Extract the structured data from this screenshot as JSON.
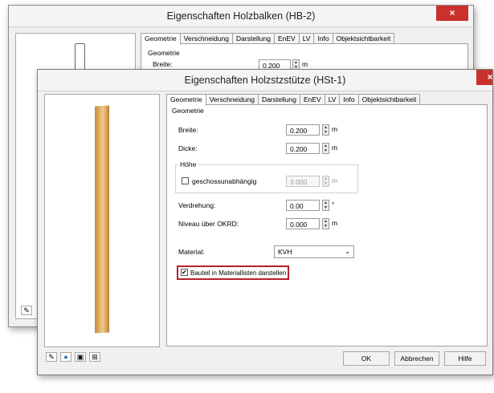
{
  "back_dialog": {
    "title": "Eigenschaften Holzbalken (HB-2)",
    "close": "×",
    "tabs": [
      "Geometrie",
      "Verschneidung",
      "Darstellung",
      "EnEV",
      "LV",
      "Info",
      "Objektsichtbarkeit"
    ],
    "group_title": "Geometrie",
    "field_label": "Breite:",
    "field_value": "0.200",
    "field_unit": "m",
    "pencil_icon": "pencil-icon"
  },
  "front_dialog": {
    "title": "Eigenschaften Holzstzstütze (HSt-1)",
    "close": "×",
    "tabs": [
      "Geometrie",
      "Verschneidung",
      "Darstellung",
      "EnEV",
      "LV",
      "Info",
      "Objektsichtbarkeit"
    ],
    "active_tab": "Geometrie",
    "group_title": "Geometrie",
    "breite": {
      "label": "Breite:",
      "value": "0.200",
      "unit": "m"
    },
    "dicke": {
      "label": "Dicke:",
      "value": "0.200",
      "unit": "m"
    },
    "hoehe": {
      "group_title": "Höhe",
      "checkbox_label": "geschossunabhängig",
      "checked": false,
      "value": "3.000",
      "unit": "m"
    },
    "verdrehung": {
      "label": "Verdrehung:",
      "value": "0.00",
      "unit": "°"
    },
    "niveau": {
      "label": "Niveau über OKRD:",
      "value": "0.000",
      "unit": "m"
    },
    "material": {
      "label": "Material:",
      "value": "KVH"
    },
    "bauteil": {
      "label": "Bauteil in Materiallisten darstellen",
      "checked": true
    },
    "buttons": {
      "ok": "OK",
      "cancel": "Abbrechen",
      "help": "Hilfe"
    },
    "toolbar_icons": [
      "pencil-icon",
      "color-icon",
      "save-icon",
      "grid-icon"
    ],
    "accent_color": "#b5212c"
  }
}
